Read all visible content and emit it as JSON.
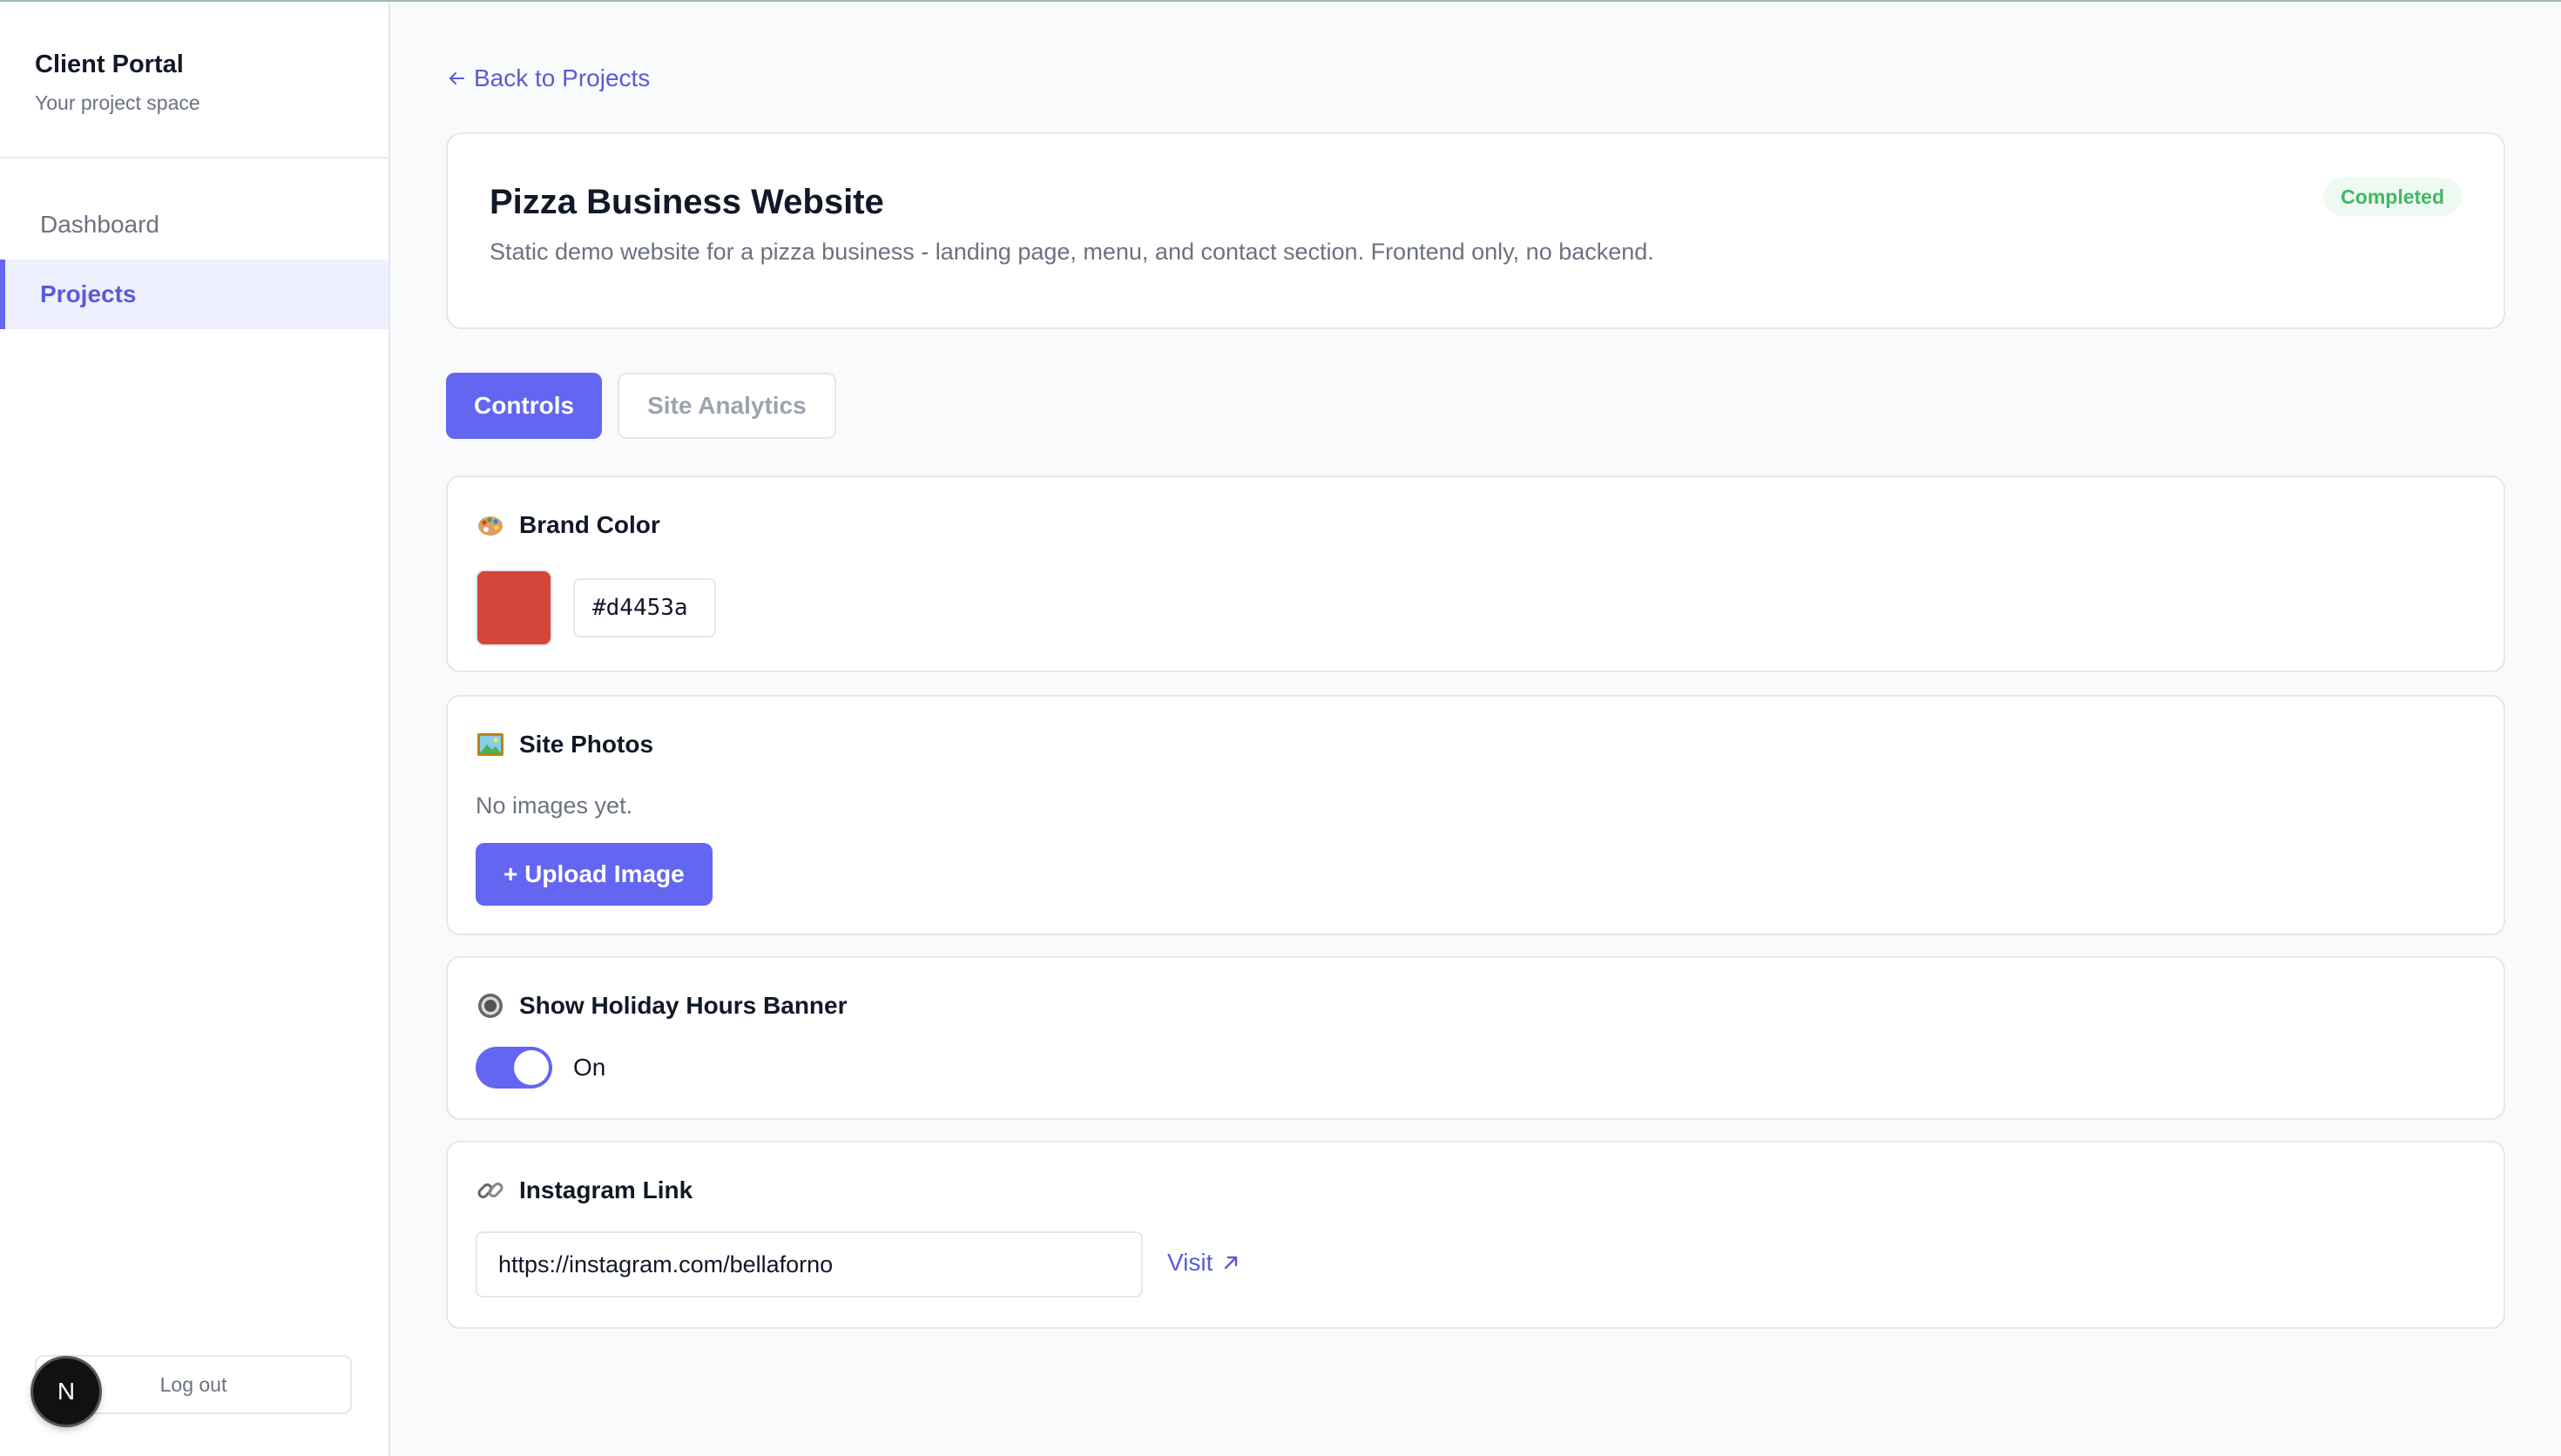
{
  "sidebar": {
    "title": "Client Portal",
    "subtitle": "Your project space",
    "items": [
      {
        "label": "Dashboard",
        "active": false
      },
      {
        "label": "Projects",
        "active": true
      }
    ],
    "logout_label": "Log out",
    "badge_letter": "N"
  },
  "main": {
    "back_label": "Back to Projects",
    "project": {
      "title": "Pizza Business Website",
      "description": "Static demo website for a pizza business - landing page, menu, and contact section. Frontend only, no backend.",
      "status": "Completed"
    },
    "tabs": [
      {
        "label": "Controls",
        "active": true
      },
      {
        "label": "Site Analytics",
        "active": false
      }
    ],
    "brand_color": {
      "title": "Brand Color",
      "icon": "palette-icon",
      "value": "#d4453a"
    },
    "site_photos": {
      "title": "Site Photos",
      "icon": "framed-picture-icon",
      "empty_message": "No images yet.",
      "upload_label": "+ Upload Image"
    },
    "holiday_banner": {
      "title": "Show Holiday Hours Banner",
      "icon": "radio-button-icon",
      "enabled": true,
      "state_label": "On"
    },
    "instagram": {
      "title": "Instagram Link",
      "icon": "link-icon",
      "value": "https://instagram.com/bellaforno",
      "visit_label": "Visit"
    }
  },
  "colors": {
    "accent": "#6366f1",
    "accent_text": "#5b5bd6",
    "success": "#3fb863",
    "brand_swatch": "#d4453a"
  }
}
